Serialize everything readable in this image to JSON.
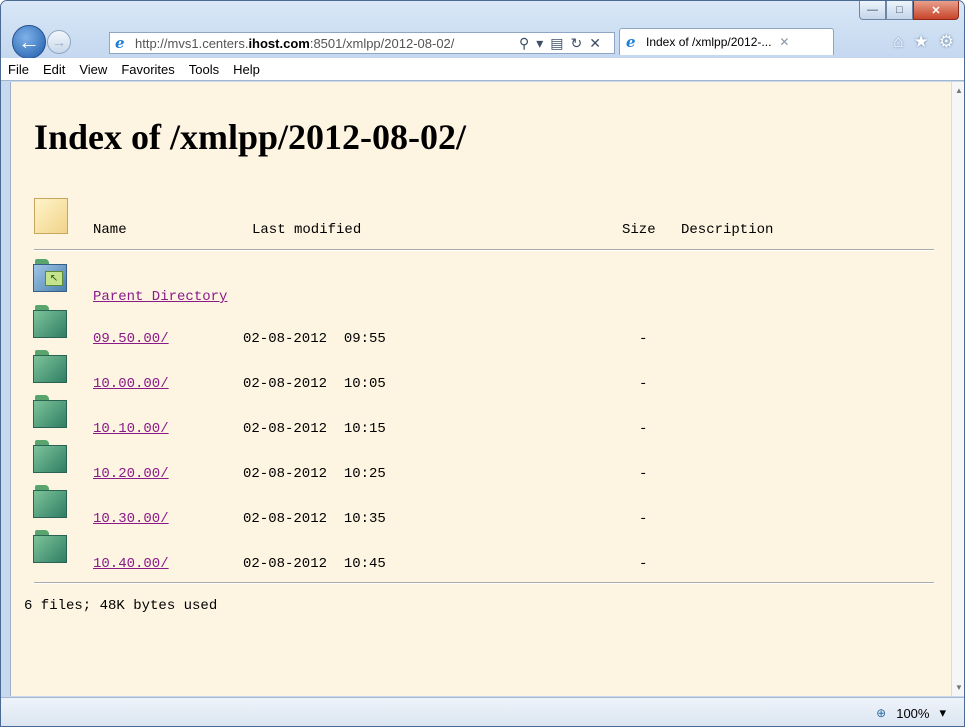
{
  "browser": {
    "url_prefix": "http://mvs1.centers.",
    "url_domain": "ihost.com",
    "url_rest": ":8501/xmlpp/2012-08-02/",
    "tab_title": "Index of /xmlpp/2012-...",
    "menu": [
      "File",
      "Edit",
      "View",
      "Favorites",
      "Tools",
      "Help"
    ],
    "zoom_level": "100%"
  },
  "page": {
    "title": "Index of /xmlpp/2012-08-02/",
    "headers": {
      "name": "Name",
      "last_modified": "Last modified",
      "size": "Size",
      "description": "Description"
    },
    "parent_link": "Parent Directory",
    "entries": [
      {
        "name": "09.50.00/",
        "date": "02-08-2012",
        "time": "09:55",
        "size": "-"
      },
      {
        "name": "10.00.00/",
        "date": "02-08-2012",
        "time": "10:05",
        "size": "-"
      },
      {
        "name": "10.10.00/",
        "date": "02-08-2012",
        "time": "10:15",
        "size": "-"
      },
      {
        "name": "10.20.00/",
        "date": "02-08-2012",
        "time": "10:25",
        "size": "-"
      },
      {
        "name": "10.30.00/",
        "date": "02-08-2012",
        "time": "10:35",
        "size": "-"
      },
      {
        "name": "10.40.00/",
        "date": "02-08-2012",
        "time": "10:45",
        "size": "-"
      }
    ],
    "footer": "6 files; 48K bytes used"
  }
}
